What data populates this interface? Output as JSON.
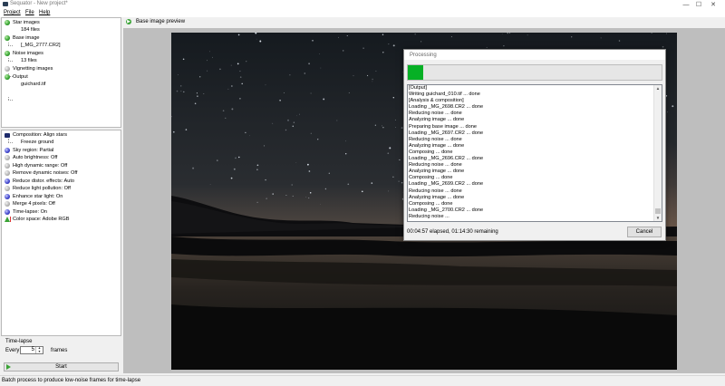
{
  "window": {
    "title": "Sequator - New project*",
    "minimize": "—",
    "maximize": "☐",
    "close": "✕"
  },
  "menu": [
    {
      "label": "Project"
    },
    {
      "label": "File"
    },
    {
      "label": "Help"
    }
  ],
  "files_tree": [
    {
      "label": "Star images",
      "status": "green",
      "child": "184 files"
    },
    {
      "label": "Base image",
      "status": "green",
      "child": "[_MG_2777.CR2]"
    },
    {
      "label": "Noise images",
      "status": "green",
      "child": "13 files"
    },
    {
      "label": "Vignetting images",
      "status": "gray",
      "child": null
    },
    {
      "label": "Output",
      "status": "green",
      "child": "guichard.tif"
    }
  ],
  "settings": [
    {
      "label": "Composition: Align stars",
      "icon": "composition",
      "child": "Freeze ground"
    },
    {
      "label": "Sky region: Partial",
      "icon": "blue"
    },
    {
      "label": "Auto brightness: Off",
      "icon": "gray"
    },
    {
      "label": "High dynamic range: Off",
      "icon": "gray"
    },
    {
      "label": "Remove dynamic noises: Off",
      "icon": "gray"
    },
    {
      "label": "Reduce distor. effects: Auto",
      "icon": "blue"
    },
    {
      "label": "Reduce light pollution: Off",
      "icon": "gray"
    },
    {
      "label": "Enhance star light: On",
      "icon": "blue"
    },
    {
      "label": "Merge 4 pixels: Off",
      "icon": "gray"
    },
    {
      "label": "Time-lapse: On",
      "icon": "blue"
    },
    {
      "label": "Color space: Adobe RGB",
      "icon": "colorspace"
    }
  ],
  "timelapse": {
    "label": "Time-lapse",
    "every_label": "Every",
    "every_value": "5",
    "frames_label": "frames",
    "start_label": "Start"
  },
  "preview": {
    "title": "Base image preview"
  },
  "dialog": {
    "title": "Processing",
    "progress": 0.06,
    "log": [
      "[Output]",
      "Writing guichard_010.tif ... done",
      "[Analysis & composition]",
      "Loading _MG_2698.CR2 ... done",
      "Reducing noise ... done",
      "Analyzing image ... done",
      "Preparing base image ... done",
      "Loading _MG_2697.CR2 ... done",
      "Reducing noise ... done",
      "Analyzing image ... done",
      "Composing ... done",
      "Loading _MG_2696.CR2 ... done",
      "Reducing noise ... done",
      "Analyzing image ... done",
      "Composing ... done",
      "Loading _MG_2699.CR2 ... done",
      "Reducing noise ... done",
      "Analyzing image ... done",
      "Composing ... done",
      "Loading _MG_2700.CR2 ... done",
      "Reducing noise ..."
    ],
    "elapsed": "00:04:57 elapsed, 01:14:30 remaining",
    "cancel_label": "Cancel"
  },
  "status_bar": "Batch process to produce low-noise frames for time-lapse",
  "colors": {
    "accent_green": "#06b025",
    "panel_border": "#b9b9b9"
  }
}
